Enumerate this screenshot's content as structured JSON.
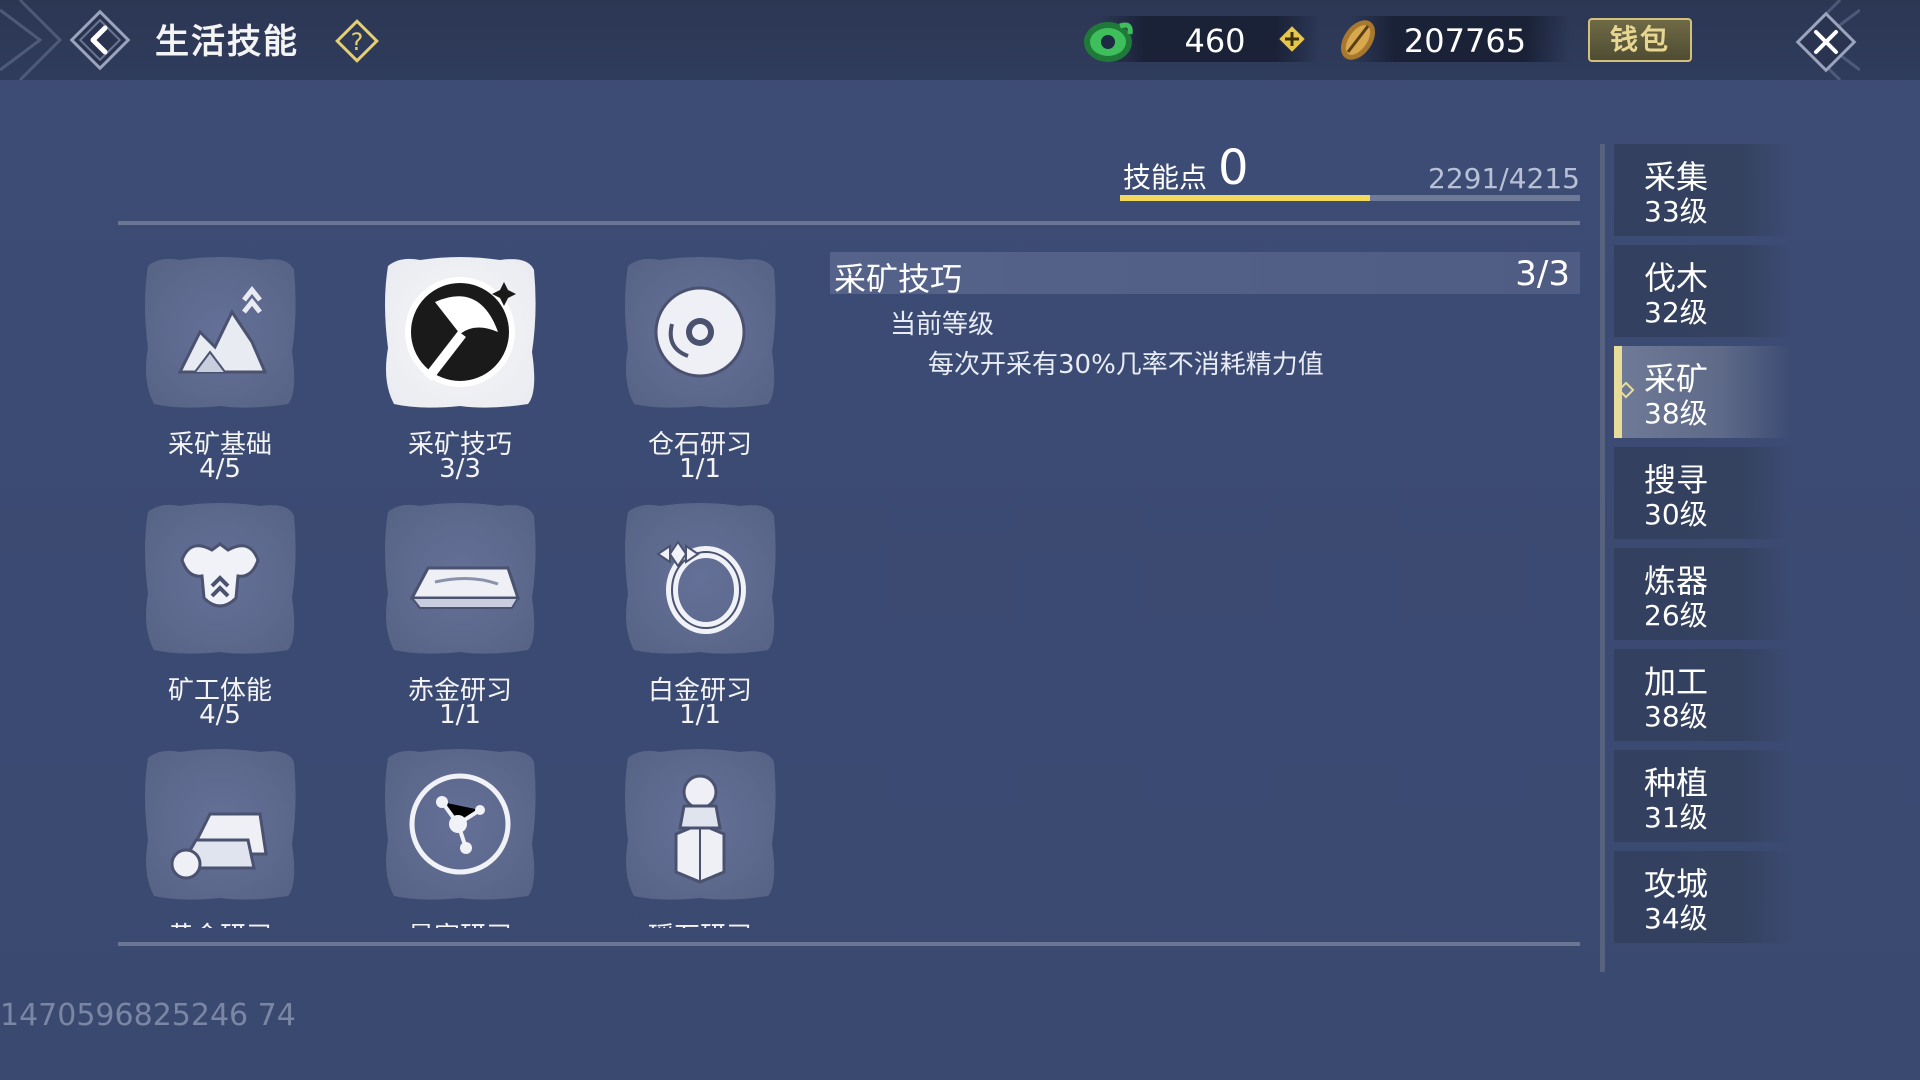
{
  "header": {
    "title": "生活技能",
    "jade_amount": "460",
    "coin_amount": "207765",
    "wallet_label": "钱包"
  },
  "skill_points": {
    "label": "技能点",
    "value": "0",
    "progress_text": "2291/4215",
    "progress_fraction": 0.5435
  },
  "skills": [
    {
      "name": "采矿基础",
      "level": "4/5",
      "icon": "ore-upgrade-icon"
    },
    {
      "name": "采矿技巧",
      "level": "3/3",
      "icon": "mining-axe-icon",
      "selected": true
    },
    {
      "name": "仓石研习",
      "level": "1/1",
      "icon": "jade-disc-icon"
    },
    {
      "name": "矿工体能",
      "level": "4/5",
      "icon": "strength-icon"
    },
    {
      "name": "赤金研习",
      "level": "1/1",
      "icon": "gold-bar-icon"
    },
    {
      "name": "白金研习",
      "level": "1/1",
      "icon": "ring-icon"
    },
    {
      "name": "黄金研习",
      "level": "",
      "icon": "gold-ingot-icon"
    },
    {
      "name": "星宿研习",
      "level": "",
      "icon": "constellation-icon"
    },
    {
      "name": "瑶石研习",
      "level": "",
      "icon": "lion-seal-icon"
    }
  ],
  "detail": {
    "title": "采矿技巧",
    "level": "3/3",
    "subheading": "当前等级",
    "description": "每次开采有30%几率不消耗精力值"
  },
  "categories": [
    {
      "name": "采集",
      "level": "33级"
    },
    {
      "name": "伐木",
      "level": "32级"
    },
    {
      "name": "采矿",
      "level": "38级",
      "active": true
    },
    {
      "name": "搜寻",
      "level": "30级"
    },
    {
      "name": "炼器",
      "level": "26级"
    },
    {
      "name": "加工",
      "level": "38级"
    },
    {
      "name": "种植",
      "level": "31级"
    },
    {
      "name": "攻城",
      "level": "34级"
    }
  ],
  "player_id": "1470596825246 74"
}
